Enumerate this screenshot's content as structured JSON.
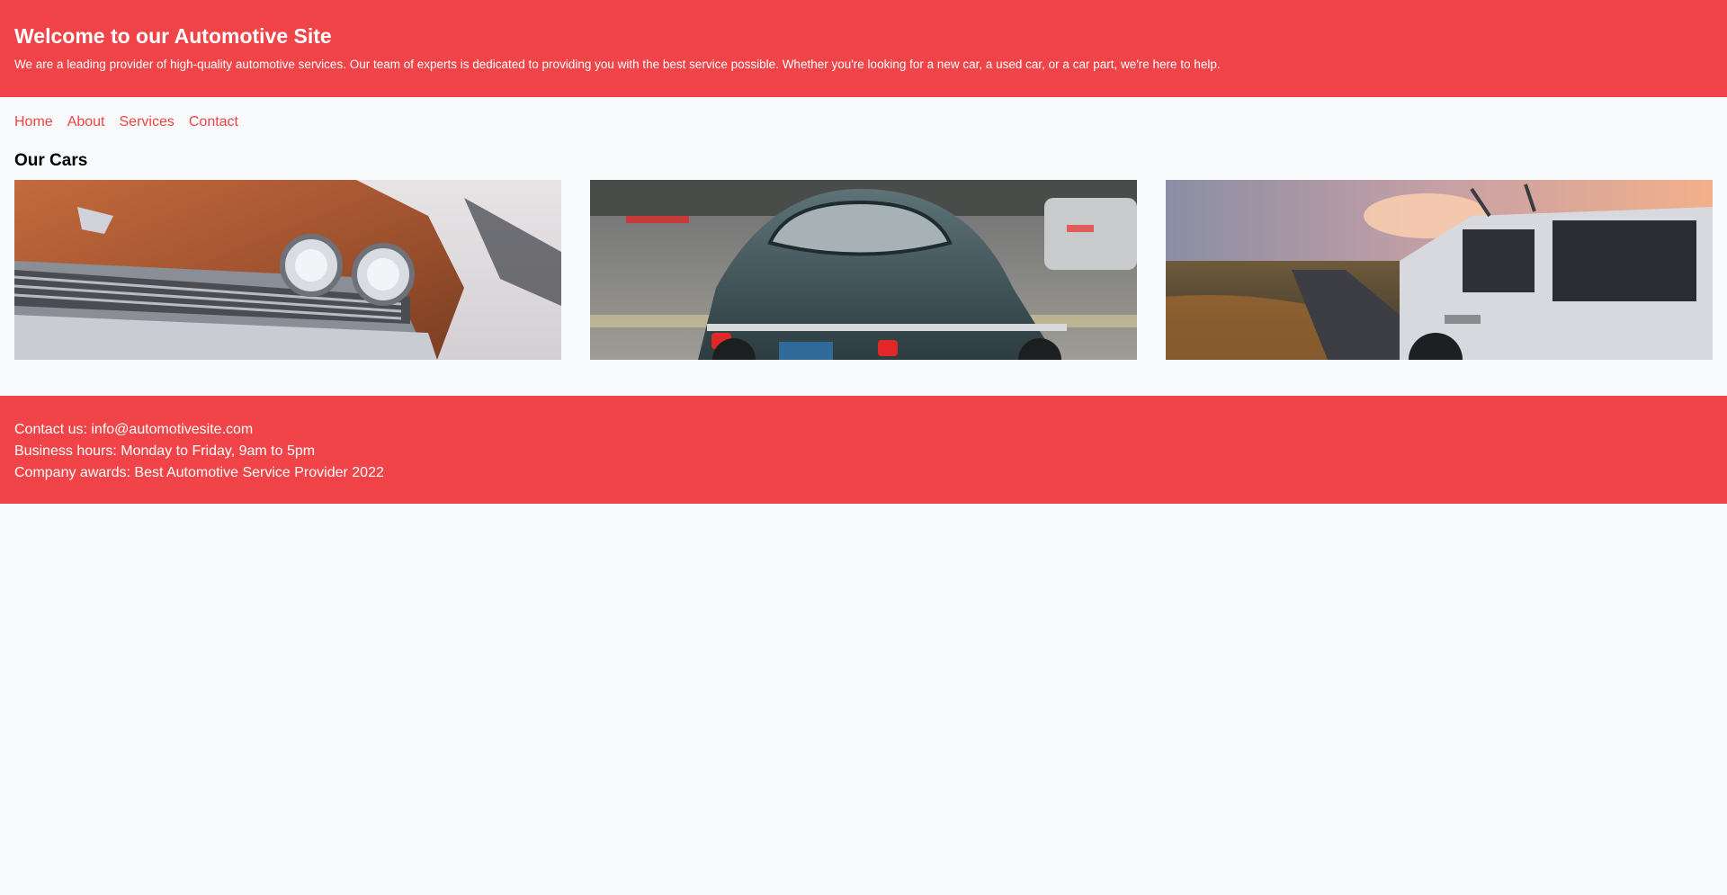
{
  "header": {
    "title": "Welcome to our Automotive Site",
    "description": "We are a leading provider of high-quality automotive services. Our team of experts is dedicated to providing you with the best service possible. Whether you're looking for a new car, a used car, or a car part, we're here to help."
  },
  "nav": {
    "items": [
      "Home",
      "About",
      "Services",
      "Contact"
    ]
  },
  "main": {
    "section_title": "Our Cars",
    "images": [
      {
        "name": "rusty-classic-car-front-image"
      },
      {
        "name": "green-vintage-sports-car-rear-image"
      },
      {
        "name": "white-offroad-suv-sunset-image"
      }
    ]
  },
  "footer": {
    "contact": "Contact us: info@automotivesite.com",
    "hours": "Business hours: Monday to Friday, 9am to 5pm",
    "awards": "Company awards: Best Automotive Service Provider 2022"
  },
  "colors": {
    "brand_red": "#f04448",
    "link_red": "#ef4444",
    "background": "#f8fafc"
  }
}
